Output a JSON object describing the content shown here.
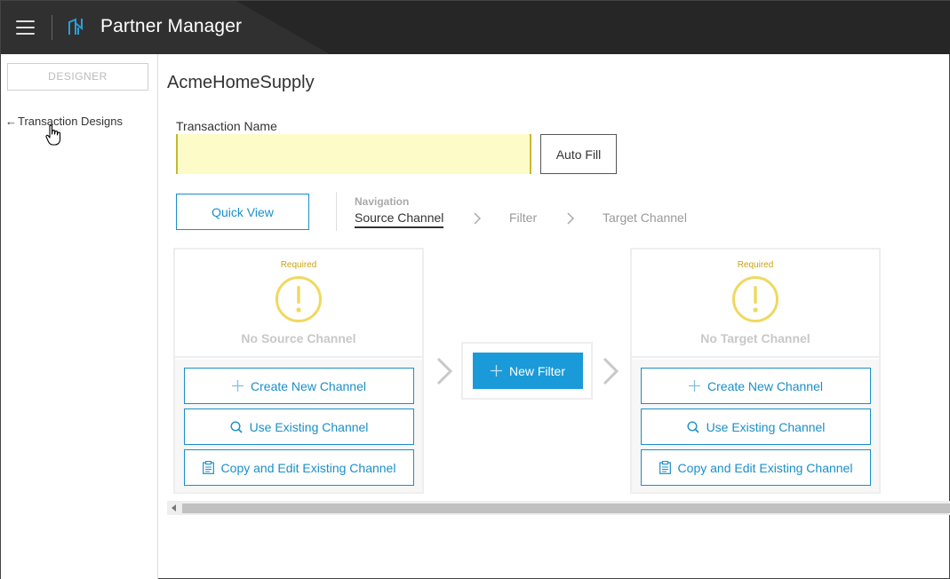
{
  "header": {
    "app_title": "Partner Manager",
    "menu_icon": "hamburger-menu-icon",
    "logo_icon": "partner-manager-logo-icon",
    "background": "#262626"
  },
  "sidebar": {
    "designer_label": "DESIGNER",
    "back_link_arrow": "←",
    "back_link_label": "Transaction Designs"
  },
  "main": {
    "page_title": "AcmeHomeSupply",
    "transaction_name_label": "Transaction Name",
    "transaction_name_value": "",
    "auto_fill_label": "Auto Fill",
    "quick_view_label": "Quick View",
    "navigation": {
      "label": "Navigation",
      "items": [
        {
          "label": "Source Channel",
          "active": true
        },
        {
          "label": "Filter",
          "active": false
        },
        {
          "label": "Target Channel",
          "active": false
        }
      ]
    }
  },
  "source_panel": {
    "required_label": "Required",
    "status_text": "No Source Channel",
    "actions": [
      {
        "label": "Create New Channel",
        "icon": "plus-icon"
      },
      {
        "label": "Use Existing Channel",
        "icon": "search-icon"
      },
      {
        "label": "Copy and Edit Existing Channel",
        "icon": "clipboard-icon"
      }
    ]
  },
  "filter_panel": {
    "new_filter_label": "New Filter",
    "icon": "plus-icon"
  },
  "target_panel": {
    "required_label": "Required",
    "status_text": "No Target Channel",
    "actions": [
      {
        "label": "Create New Channel",
        "icon": "plus-icon"
      },
      {
        "label": "Use Existing Channel",
        "icon": "search-icon"
      },
      {
        "label": "Copy and Edit Existing Channel",
        "icon": "clipboard-icon"
      }
    ]
  },
  "colors": {
    "accent": "#1a8fc8",
    "primary_button": "#1a9ad8",
    "warning": "#f0d860",
    "required_text": "#c8a415",
    "input_highlight": "#fdfcc8"
  }
}
